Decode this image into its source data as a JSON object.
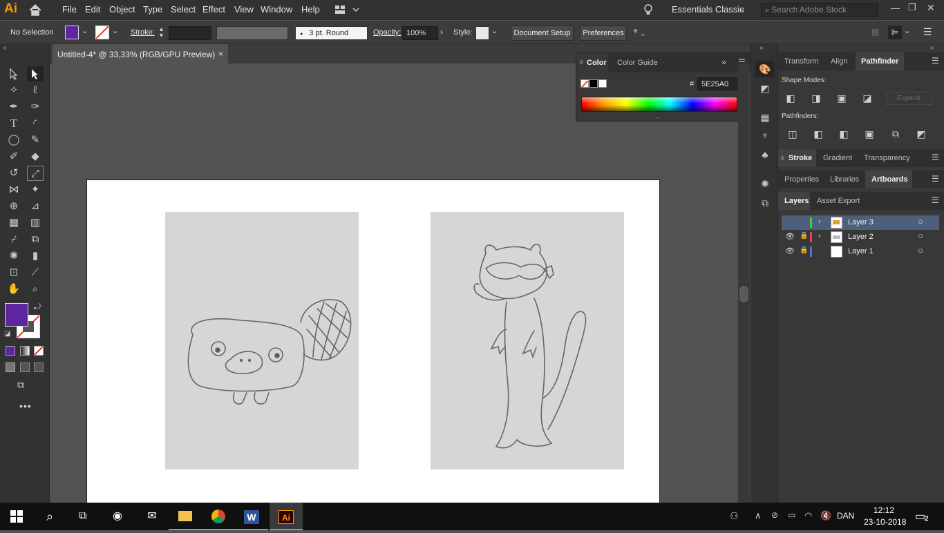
{
  "app": {
    "logo": "Ai",
    "menus": [
      "File",
      "Edit",
      "Object",
      "Type",
      "Select",
      "Effect",
      "View",
      "Window",
      "Help"
    ],
    "workspace": "Essentials Classic",
    "search_placeholder": "Search Adobe Stock"
  },
  "control": {
    "selection": "No Selection",
    "fill_color": "#5E25A0",
    "stroke_label": "Stroke:",
    "brush": "3 pt. Round",
    "opacity_label": "Opacity:",
    "opacity_value": "100%",
    "style_label": "Style:",
    "doc_setup": "Document Setup",
    "preferences": "Preferences"
  },
  "document": {
    "tab_title": "Untitled-4* @ 33,33% (RGB/GPU Preview)"
  },
  "color_panel": {
    "tab_color": "Color",
    "tab_guide": "Color Guide",
    "hex_label": "#",
    "hex_value": "5E25A0"
  },
  "panels": {
    "group1": {
      "tabs": [
        "Transform",
        "Align",
        "Pathfinder"
      ],
      "active": "Pathfinder",
      "shape_modes": "Shape Modes:",
      "expand": "Expand",
      "pathfinders": "Pathfinders:"
    },
    "group2": {
      "tabs": [
        "Stroke",
        "Gradient",
        "Transparency"
      ],
      "active": "Stroke"
    },
    "group3": {
      "tabs": [
        "Properties",
        "Libraries",
        "Artboards"
      ],
      "active": "Artboards"
    },
    "group4": {
      "tabs": [
        "Layers",
        "Asset Export"
      ],
      "active": "Layers"
    }
  },
  "layers": [
    {
      "name": "Layer 3",
      "color": "#3bd33b",
      "selected": true
    },
    {
      "name": "Layer 2",
      "color": "#e24343",
      "selected": false
    },
    {
      "name": "Layer 1",
      "color": "#4e6ff0",
      "selected": false
    }
  ],
  "taskbar": {
    "lang": "DAN",
    "time": "12:12",
    "date": "23-10-2018",
    "notifications": "2"
  }
}
